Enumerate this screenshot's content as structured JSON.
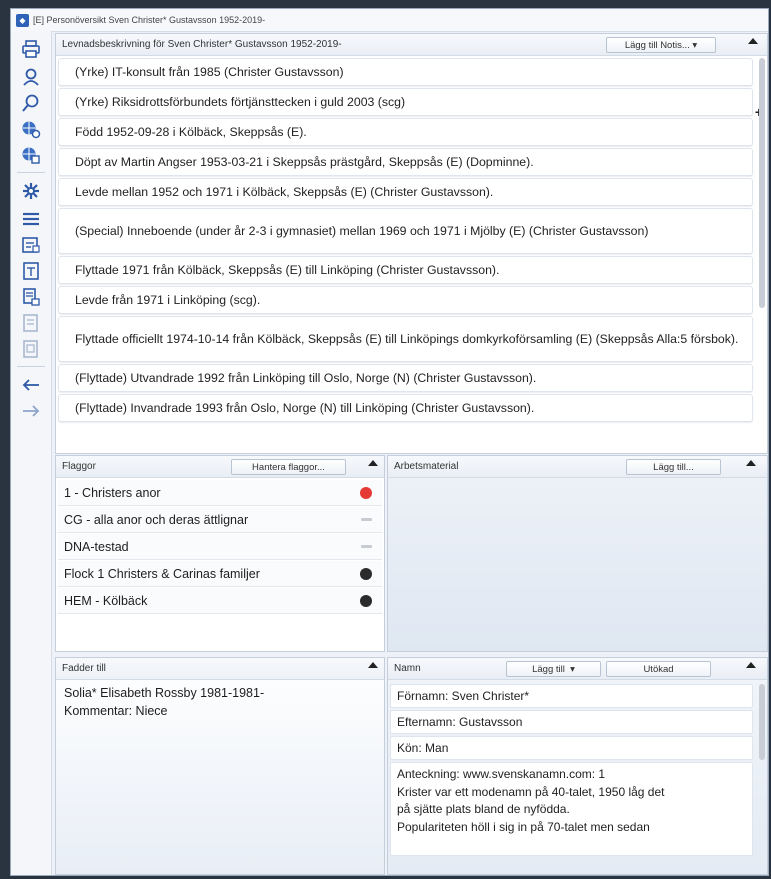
{
  "window": {
    "title": "[E] Personöversikt Sven Christer* Gustavsson 1952-2019-"
  },
  "toolbar": {
    "icons": [
      "print-icon",
      "person-search-icon",
      "search-icon",
      "globe-gear-icon",
      "globe-doc-icon",
      "settings-icon",
      "menu-icon",
      "picture-doc-icon",
      "document-doc-icon",
      "tree-doc-icon",
      "faded-doc-icon",
      "faded-doc-2-icon",
      "back-arrow-icon",
      "forward-arrow-icon"
    ]
  },
  "biography": {
    "title": "Levnadsbeskrivning för Sven Christer* Gustavsson 1952-2019-",
    "add_note_label": "Lägg till Notis...",
    "events": [
      "(Yrke) IT-konsult från 1985 (Christer Gustavsson)",
      "(Yrke) Riksidrottsförbundets förtjänsttecken i guld 2003 (scg)",
      "Född 1952-09-28 i Kölbäck, Skeppsås (E).",
      "Döpt av Martin Angser 1953-03-21 i Skeppsås prästgård, Skeppsås (E) (Dopminne).",
      "Levde mellan 1952 och 1971 i Kölbäck, Skeppsås (E) (Christer Gustavsson).",
      "(Special) Inneboende (under år 2-3 i gymnasiet) mellan 1969 och 1971 i Mjölby (E) (Christer Gustavsson)",
      "Flyttade 1971 från Kölbäck, Skeppsås (E) till Linköping (Christer Gustavsson).",
      "Levde från 1971 i Linköping (scg).",
      "Flyttade officiellt 1974-10-14 från Kölbäck, Skeppsås (E) till Linköpings domkyrkoförsamling (E) (Skeppsås Alla:5 försbok).",
      "(Flyttade) Utvandrade 1992 från Linköping till Oslo, Norge (N) (Christer Gustavsson).",
      "(Flyttade) Invandrade 1993 från Oslo, Norge (N) till Linköping (Christer Gustavsson)."
    ]
  },
  "flags": {
    "title": "Flaggor",
    "manage_label": "Hantera flaggor...",
    "items": [
      {
        "label": "1 - Christers anor",
        "color": "#e53935"
      },
      {
        "label": "CG  - alla anor och deras ättlignar",
        "color": "#c8ccd2"
      },
      {
        "label": "DNA-testad",
        "color": "#c8ccd2"
      },
      {
        "label": "Flock 1 Christers & Carinas familjer",
        "color": "#2b2b2b"
      },
      {
        "label": "HEM - Kölbäck",
        "color": "#2b2b2b"
      }
    ]
  },
  "work": {
    "title": "Arbetsmaterial",
    "add_label": "Lägg till..."
  },
  "godparent": {
    "title": "Fadder till",
    "line1": "Solia* Elisabeth Rossby 1981-1981-",
    "line2": "Kommentar: Niece"
  },
  "names": {
    "title": "Namn",
    "add_label": "Lägg till",
    "extended_label": "Utökad",
    "rows": [
      "Förnamn: Sven Christer*",
      "Efternamn: Gustavsson",
      "Kön: Man"
    ],
    "note": [
      "Anteckning: www.svenskanamn.com: 1",
      "Krister var ett modenamn på 40-talet, 1950 låg det",
      "på sjätte plats bland de nyfödda.",
      "Populariteten höll i sig in på 70-talet men sedan"
    ]
  }
}
